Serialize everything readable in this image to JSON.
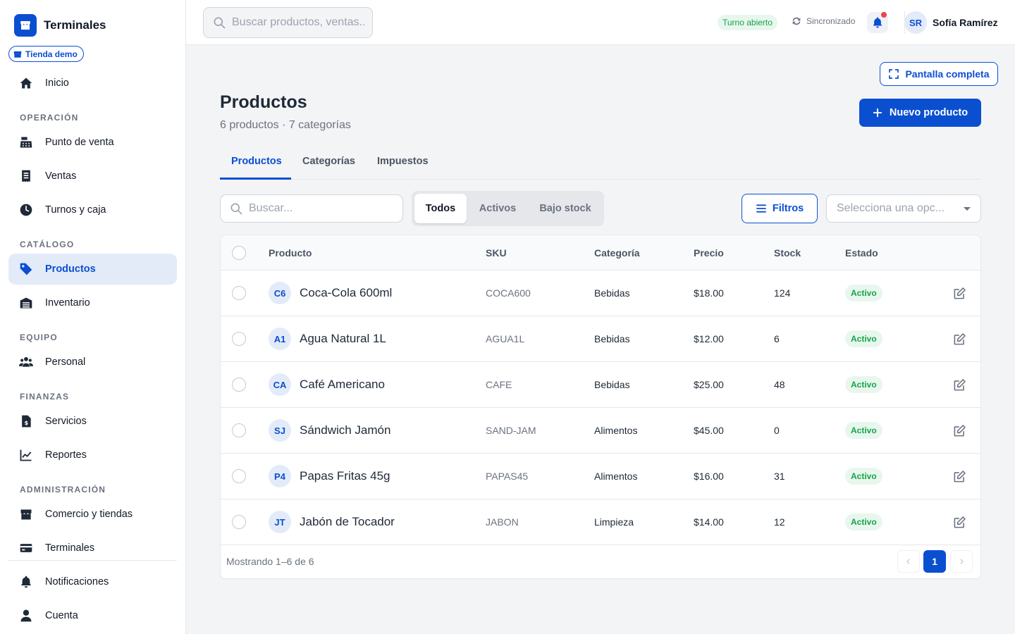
{
  "brand": {
    "name": "Terminales",
    "store": "Tienda demo"
  },
  "sidebar": {
    "home": "Inicio",
    "sections": [
      {
        "title": "OPERACIÓN",
        "items": [
          "Punto de venta",
          "Ventas",
          "Turnos y caja"
        ]
      },
      {
        "title": "CATÁLOGO",
        "items": [
          "Productos",
          "Inventario"
        ]
      },
      {
        "title": "EQUIPO",
        "items": [
          "Personal"
        ]
      },
      {
        "title": "FINANZAS",
        "items": [
          "Servicios",
          "Reportes"
        ]
      },
      {
        "title": "ADMINISTRACIÓN",
        "items": [
          "Comercio y tiendas",
          "Terminales"
        ]
      }
    ],
    "bottom": [
      "Notificaciones",
      "Cuenta"
    ]
  },
  "topbar": {
    "search_placeholder": "Buscar productos, ventas...",
    "shift_status": "Turno abierto",
    "sync_status": "Sincronizado",
    "user_initials": "SR",
    "user_name": "Sofía Ramírez"
  },
  "page": {
    "fullscreen_label": "Pantalla completa",
    "title": "Productos",
    "subtitle": "6 productos · 7 categorías",
    "new_button": "Nuevo producto",
    "tabs": [
      "Productos",
      "Categorías",
      "Impuestos"
    ]
  },
  "toolbar": {
    "search_placeholder": "Buscar...",
    "segments": [
      "Todos",
      "Activos",
      "Bajo stock"
    ],
    "filters_label": "Filtros",
    "select_placeholder": "Selecciona una opc..."
  },
  "table": {
    "headers": [
      "Producto",
      "SKU",
      "Categoría",
      "Precio",
      "Stock",
      "Estado"
    ],
    "rows": [
      {
        "initials": "C6",
        "name": "Coca-Cola 600ml",
        "sku": "COCA600",
        "category": "Bebidas",
        "price": "$18.00",
        "stock": "124",
        "status": "Activo"
      },
      {
        "initials": "A1",
        "name": "Agua Natural 1L",
        "sku": "AGUA1L",
        "category": "Bebidas",
        "price": "$12.00",
        "stock": "6",
        "status": "Activo"
      },
      {
        "initials": "CA",
        "name": "Café Americano",
        "sku": "CAFE",
        "category": "Bebidas",
        "price": "$25.00",
        "stock": "48",
        "status": "Activo"
      },
      {
        "initials": "SJ",
        "name": "Sándwich Jamón",
        "sku": "SAND-JAM",
        "category": "Alimentos",
        "price": "$45.00",
        "stock": "0",
        "status": "Activo"
      },
      {
        "initials": "P4",
        "name": "Papas Fritas 45g",
        "sku": "PAPAS45",
        "category": "Alimentos",
        "price": "$16.00",
        "stock": "31",
        "status": "Activo"
      },
      {
        "initials": "JT",
        "name": "Jabón de Tocador",
        "sku": "JABON",
        "category": "Limpieza",
        "price": "$14.00",
        "stock": "12",
        "status": "Activo"
      }
    ],
    "footer": "Mostrando 1–6 de 6",
    "current_page": "1"
  },
  "colors": {
    "accent": "#0b4fd1",
    "success": "#16a34a",
    "danger": "#ef4444"
  }
}
